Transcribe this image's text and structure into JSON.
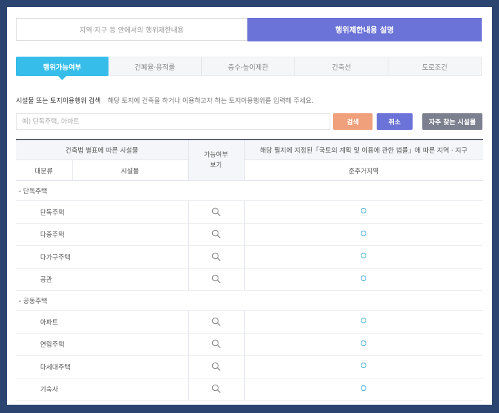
{
  "top_toggle": {
    "left_label": "지역·지구 등 안에서의 행위제한내용",
    "right_label": "행위제한내용 설명"
  },
  "tabs": [
    {
      "label": "행위가능여부",
      "active": true
    },
    {
      "label": "건폐율·용적률",
      "active": false
    },
    {
      "label": "층수·높이제한",
      "active": false
    },
    {
      "label": "건축선",
      "active": false
    },
    {
      "label": "도로조건",
      "active": false
    }
  ],
  "search": {
    "label": "시설물 또는 토지이용행위 검색",
    "hint": "해당 토지에 건축을 하거나 이용하고자 하는 토지이용행위를 입력해 주세요.",
    "placeholder": "예) 단독주택, 아파트",
    "value": "",
    "search_button": "검색",
    "cancel_button": "취소",
    "frequent_button": "자주 찾는 시설물"
  },
  "table": {
    "header": {
      "building_law": "건축법 별표에 따른 시설물",
      "possible": "가능여부 보기",
      "zone_desc": "해당 필지에 지정된「국토의 계획 및 이용에 관한 법률」에 따른 지역 · 지구",
      "category": "대분류",
      "facility": "시설물",
      "zone": "준주거지역"
    },
    "groups": [
      {
        "label": "- 단독주택",
        "items": [
          {
            "name": "단독주택",
            "allowed": "O"
          },
          {
            "name": "다중주택",
            "allowed": "O"
          },
          {
            "name": "다가구주택",
            "allowed": "O"
          },
          {
            "name": "공관",
            "allowed": "O"
          }
        ]
      },
      {
        "label": "- 공동주택",
        "items": [
          {
            "name": "아파트",
            "allowed": "O"
          },
          {
            "name": "연립주택",
            "allowed": "O"
          },
          {
            "name": "다세대주택",
            "allowed": "O"
          },
          {
            "name": "기숙사",
            "allowed": "O"
          }
        ]
      }
    ]
  },
  "colors": {
    "accent_blue": "#36bdea",
    "accent_purple": "#6b72d8",
    "search_orange": "#f0a07a",
    "frequent_gray": "#7c7f8e",
    "background": "#2b4470"
  },
  "icons": {
    "view": "magnifier-icon",
    "allowed": "circle-icon"
  }
}
